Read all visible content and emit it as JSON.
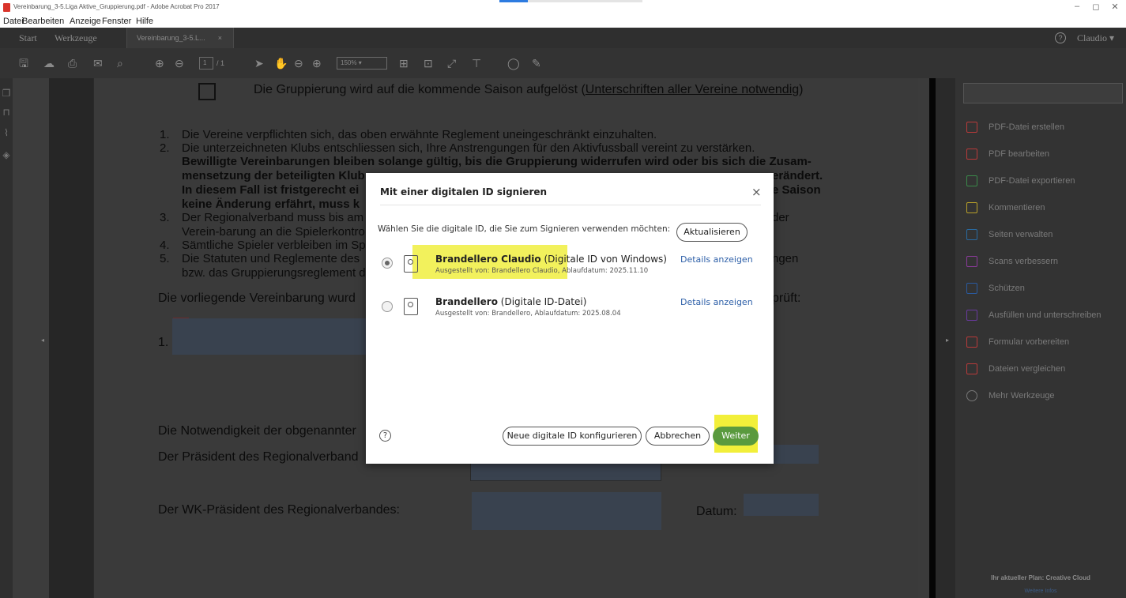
{
  "window": {
    "title": "Vereinbarung_3-5.Liga Aktive_Gruppierung.pdf - Adobe Acrobat Pro 2017",
    "controls": [
      "–",
      "◻",
      "✕"
    ]
  },
  "menu": [
    "Datei",
    "Bearbeiten",
    "Anzeige",
    "Fenster",
    "Hilfe"
  ],
  "tabs": {
    "start": "Start",
    "tools": "Werkzeuge",
    "document": "Vereinbarung_3-5.L...",
    "document_close": "×",
    "help": "?",
    "user": "Claudio"
  },
  "toolbar": {
    "page_current": "1",
    "page_total": "/ 1",
    "zoom": "150%"
  },
  "document": {
    "heading_text": "Die Gruppierung wird auf die kommende Saison aufgelöst (",
    "heading_link": "Unterschriften aller Vereine notwendig",
    "heading_close": ")",
    "list": [
      {
        "num": "1.",
        "text": "Die Vereine verpflichten sich, das oben erwähnte Reglement uneingeschränkt einzuhalten."
      },
      {
        "num": "2.",
        "text": "Die unterzeichneten Klubs entschliessen sich, Ihre Anstrengungen für den Aktivfussball vereint zu verstärken."
      }
    ],
    "bold_line1": "Bewilligte Vereinbarungen bleiben solange gültig, bis die Gruppierung widerrufen wird oder bis sich die Zusam-",
    "bold_line2a": "mensetzung der beteiligten Klub",
    "bold_line2b": "erändert.",
    "bold_line3a": "In diesem Fall ist fristgerecht ei",
    "bold_line3b": "e Saison",
    "bold_line4a": "keine Änderung erfährt, muss k",
    "item3_num": "3.",
    "item3a": "Der Regionalverband muss bis am",
    "item3b": "der",
    "item3_line2": "Verein-barung an die Spielerkontro",
    "item4_num": "4.",
    "item4": "Sämtliche Spieler verbleiben im Sp",
    "item5_num": "5.",
    "item5a": "Die Statuten und Reglemente des",
    "item5b": "ngen",
    "item5_line2": "bzw. das Gruppierungsreglement d",
    "verified_a": "Die vorliegende Vereinbarung wurd",
    "verified_b": "prüft:",
    "sig_num": "1.",
    "necessity": "Die Notwendigkeit der obgenannter",
    "president": "Der Präsident des Regionalverband",
    "wk_president": "Der WK-Präsident des Regionalverbandes:",
    "date_label": "Datum:"
  },
  "right_panel": {
    "tools": [
      {
        "label": "PDF-Datei erstellen",
        "icon": "create-pdf-icon",
        "color": "#b83a3a"
      },
      {
        "label": "PDF bearbeiten",
        "icon": "edit-pdf-icon",
        "color": "#b83a3a"
      },
      {
        "label": "PDF-Datei exportieren",
        "icon": "export-pdf-icon",
        "color": "#3a8a4a"
      },
      {
        "label": "Kommentieren",
        "icon": "comment-icon",
        "color": "#b8a02a"
      },
      {
        "label": "Seiten verwalten",
        "icon": "organize-pages-icon",
        "color": "#2a6aa0"
      },
      {
        "label": "Scans verbessern",
        "icon": "enhance-scans-icon",
        "color": "#8a3a9a"
      },
      {
        "label": "Schützen",
        "icon": "protect-icon",
        "color": "#2a5aa0"
      },
      {
        "label": "Ausfüllen und unterschreiben",
        "icon": "fill-sign-icon",
        "color": "#6a3aa0"
      },
      {
        "label": "Formular vorbereiten",
        "icon": "prepare-form-icon",
        "color": "#b83a3a"
      },
      {
        "label": "Dateien vergleichen",
        "icon": "compare-files-icon",
        "color": "#b83a3a"
      },
      {
        "label": "Mehr Werkzeuge",
        "icon": "more-tools-icon",
        "color": "#777777"
      }
    ],
    "plan": "Ihr aktueller Plan: Creative Cloud",
    "more_info": "Weitere Infos"
  },
  "dialog": {
    "title": "Mit einer digitalen ID signieren",
    "close": "×",
    "prompt": "Wählen Sie die digitale ID, die Sie zum Signieren verwenden möchten:",
    "refresh": "Aktualisieren",
    "ids": [
      {
        "name": "Brandellero Claudio",
        "type": " (Digitale ID von Windows)",
        "issued": "Ausgestellt von: Brandellero Claudio, Ablaufdatum: 2025.11.10",
        "details": "Details anzeigen",
        "selected": true
      },
      {
        "name": "Brandellero",
        "type": " (Digitale ID-Datei)",
        "issued": "Ausgestellt von: Brandellero, Ablaufdatum: 2025.08.04",
        "details": "Details anzeigen",
        "selected": false
      }
    ],
    "help": "?",
    "configure": "Neue digitale ID konfigurieren",
    "cancel": "Abbrechen",
    "next": "Weiter",
    "highlight_color": "#f1ef4a",
    "accent": "#5a9a3e"
  }
}
